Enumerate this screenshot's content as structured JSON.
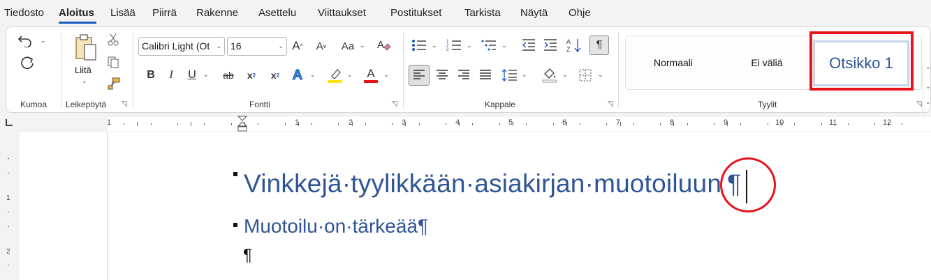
{
  "menu": {
    "tabs": [
      "Tiedosto",
      "Aloitus",
      "Lisää",
      "Piirrä",
      "Rakenne",
      "Asettelu",
      "Viittaukset",
      "Postitukset",
      "Tarkista",
      "Näytä",
      "Ohje"
    ]
  },
  "groups": {
    "undo": "Kumoa",
    "clipboard": "Leikepöytä",
    "font": "Fontti",
    "paragraph": "Kappale",
    "styles": "Tyylit"
  },
  "clipboard": {
    "paste_label": "Liitä"
  },
  "font": {
    "name": "Calibri Light (Ot",
    "size": "16",
    "bold": "B",
    "italic": "I",
    "underline": "U",
    "strike": "ab",
    "subscript": "x",
    "superscript": "x",
    "effects": "A",
    "color_letter": "A",
    "change_case": "Aa",
    "grow": "A",
    "shrink": "A"
  },
  "styles": {
    "items": [
      "Normaali",
      "Ei väliä",
      "Otsikko 1"
    ]
  },
  "ruler": {
    "numbers": [
      "1",
      "2",
      "1",
      "2",
      "3",
      "4",
      "5",
      "6",
      "7",
      "8",
      "9",
      "10",
      "11",
      "12"
    ],
    "vertical_numbers": [
      "1",
      "2"
    ]
  },
  "document": {
    "heading1": "Vinkkejä·tyylikkään·asiakirjan·muotoiluun",
    "heading1_mark": "¶",
    "heading2": "Muotoilu·on·tärkeää¶",
    "empty_paragraph": "¶"
  },
  "colors": {
    "accent": "#185abd",
    "heading": "#2f5597",
    "highlight_red": "#e8141c",
    "highlight_yellow": "#ffe600",
    "font_color_red": "#e8141c"
  }
}
